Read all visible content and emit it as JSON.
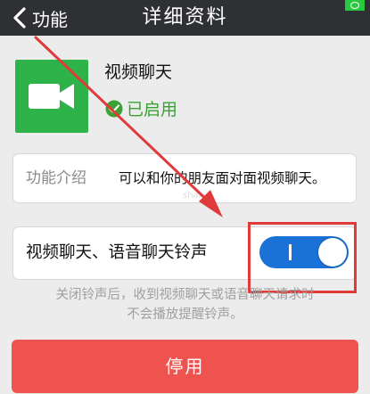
{
  "header": {
    "back_label": "功能",
    "title": "详细资料"
  },
  "app": {
    "name": "视频聊天",
    "status": "已启用"
  },
  "intro": {
    "label": "功能介绍",
    "text": "可以和你的朋友面对面视频聊天。"
  },
  "ringtone": {
    "label": "视频聊天、语音聊天铃声",
    "enabled": true,
    "hint_line1": "关闭铃声后，收到视频聊天或语音聊天请求时",
    "hint_line2": "不会播放提醒铃声。"
  },
  "actions": {
    "disable_label": "停用"
  },
  "watermark": "shan",
  "colors": {
    "header_bg": "#2e3033",
    "app_icon_bg": "#2db34a",
    "enabled_text": "#3aa235",
    "toggle_on": "#1a71d6",
    "disable_button": "#ef5350",
    "annotation": "#e03b3b"
  },
  "icons": {
    "back": "chevron-left-icon",
    "app": "video-camera-icon",
    "status": "check-circle-icon",
    "battery": "battery-icon"
  }
}
